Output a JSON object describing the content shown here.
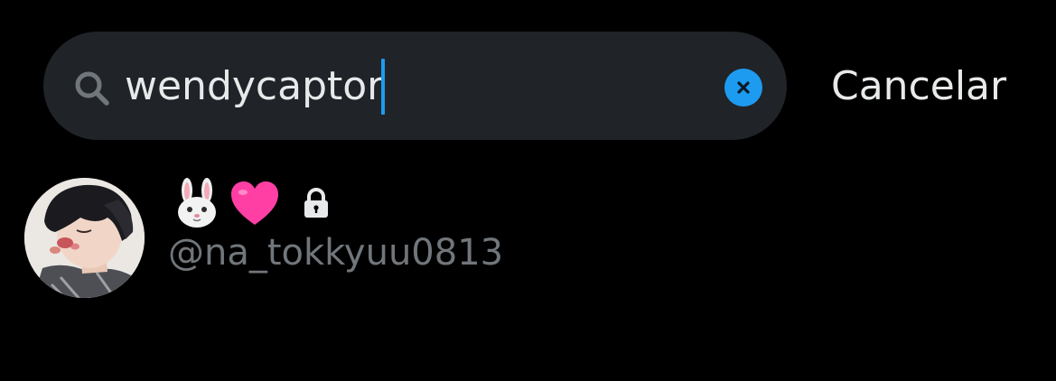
{
  "search": {
    "value": "wendycaptor",
    "cancel_label": "Cancelar"
  },
  "results": [
    {
      "display_name_icons": [
        "rabbit-face-emoji",
        "pink-heart-emoji",
        "lock-icon"
      ],
      "handle": "@na_tokkyuu0813",
      "protected": true
    }
  ],
  "colors": {
    "background": "#000000",
    "search_bg": "#202327",
    "accent": "#1d9bf0",
    "primary_text": "#e7e9ea",
    "secondary_text": "#71767b"
  }
}
